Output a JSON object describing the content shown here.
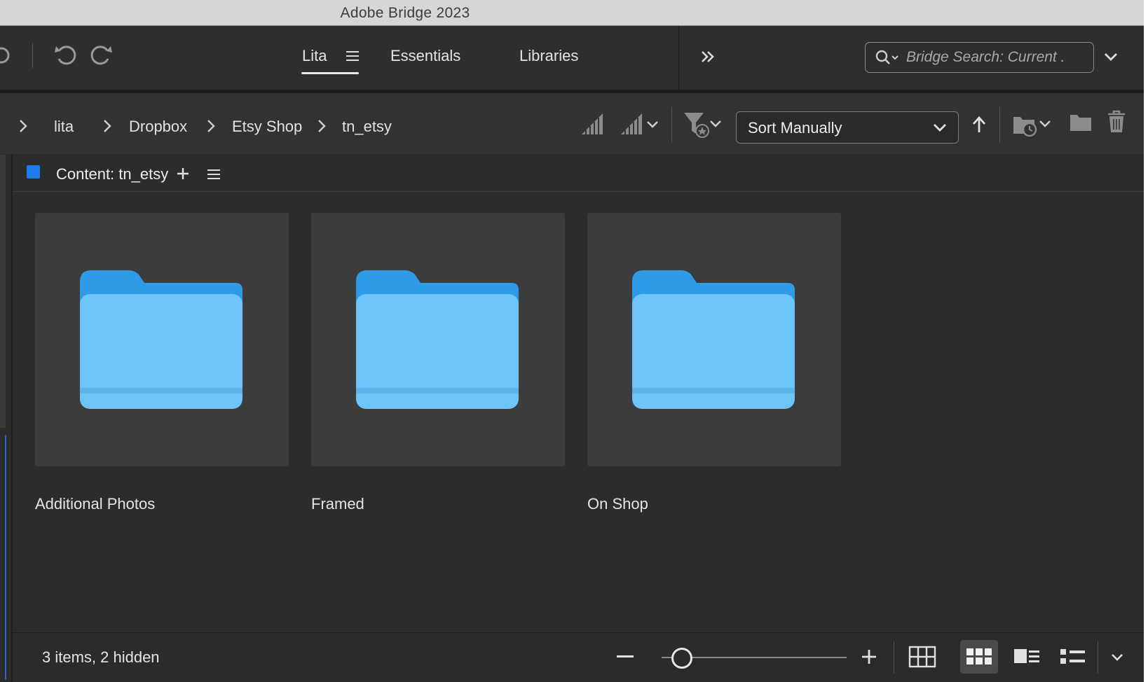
{
  "window": {
    "title": "Adobe Bridge 2023"
  },
  "toolbar": {
    "tabs": [
      {
        "label": "Lita",
        "active": true
      },
      {
        "label": "Essentials",
        "active": false
      },
      {
        "label": "Libraries",
        "active": false
      }
    ],
    "search_placeholder": "Bridge Search: Current ."
  },
  "pathbar": {
    "crumbs": [
      "lita",
      "Dropbox",
      "Etsy Shop",
      "tn_etsy"
    ],
    "sort_label": "Sort Manually"
  },
  "content": {
    "panel_title": "Content: tn_etsy",
    "items": [
      {
        "name": "Additional Photos"
      },
      {
        "name": "Framed"
      },
      {
        "name": "On Shop"
      }
    ]
  },
  "status": {
    "count": "3 items, 2 hidden",
    "thumbnail_size_level": 0.06
  },
  "colors": {
    "accent": "#1e7ce9",
    "folder": "#6cc4f7",
    "background": "#2b2b2b"
  }
}
